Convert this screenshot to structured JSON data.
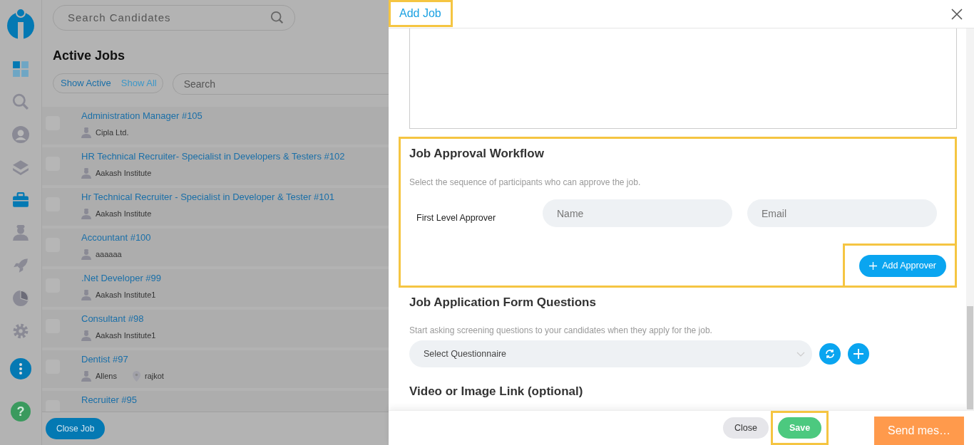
{
  "sidebar": {
    "items": [
      {
        "kind": "dashboard",
        "selected": false
      },
      {
        "kind": "search",
        "selected": false
      },
      {
        "kind": "profile",
        "selected": false
      },
      {
        "kind": "layers",
        "selected": false
      },
      {
        "kind": "briefcase",
        "selected": true
      },
      {
        "kind": "person",
        "selected": false
      },
      {
        "kind": "rocket",
        "selected": false
      },
      {
        "kind": "pie",
        "selected": false
      },
      {
        "kind": "gear",
        "selected": false
      }
    ],
    "help": "?"
  },
  "search": {
    "placeholder": "Search Candidates"
  },
  "page_title": "Active Jobs",
  "filters": [
    {
      "label": "Show Active",
      "selected": true
    },
    {
      "label": "Show All",
      "selected": false
    }
  ],
  "job_search": {
    "placeholder": "Search"
  },
  "jobs": [
    {
      "title": "Administration Manager #105",
      "company": "Cipla Ltd.",
      "checked": false
    },
    {
      "title": "HR Technical Recruiter- Specialist in Developers & Testers #102",
      "company": "Aakash Institute",
      "checked": false
    },
    {
      "title": "Hr Technical Recruiter - Specialist in Developer & Tester #101",
      "company": "Aakash Institute",
      "checked": false
    },
    {
      "title": "Accountant #100",
      "company": "aaaaaa",
      "checked": false
    },
    {
      "title": ".Net Developer #99",
      "company": "Aakash Institute1",
      "checked": false
    },
    {
      "title": "Consultant #98",
      "company": "Aakash Institute1",
      "checked": false
    },
    {
      "title": "Dentist #97",
      "company": "Allens",
      "location": "rajkot",
      "checked": false
    },
    {
      "title": "Recruiter #95",
      "checked": false
    }
  ],
  "close_job_button": "Close Job",
  "modal": {
    "title": "Add Job",
    "approval": {
      "heading": "Job Approval Workflow",
      "description": "Select the sequence of participants who can approve the job.",
      "level_label": "First Level Approver",
      "name_placeholder": "Name",
      "email_placeholder": "Email",
      "add_button": "Add Approver"
    },
    "questions": {
      "heading": "Job Application Form Questions",
      "description": "Start asking screening questions to your candidates when they apply for the job.",
      "select_value": "Select Questionnaire"
    },
    "video_heading": "Video or Image Link (optional)",
    "buttons": [
      {
        "label": "Close",
        "kind": "secondary"
      },
      {
        "label": "Save",
        "kind": "primary"
      }
    ]
  },
  "chat_button": "Send mes…"
}
